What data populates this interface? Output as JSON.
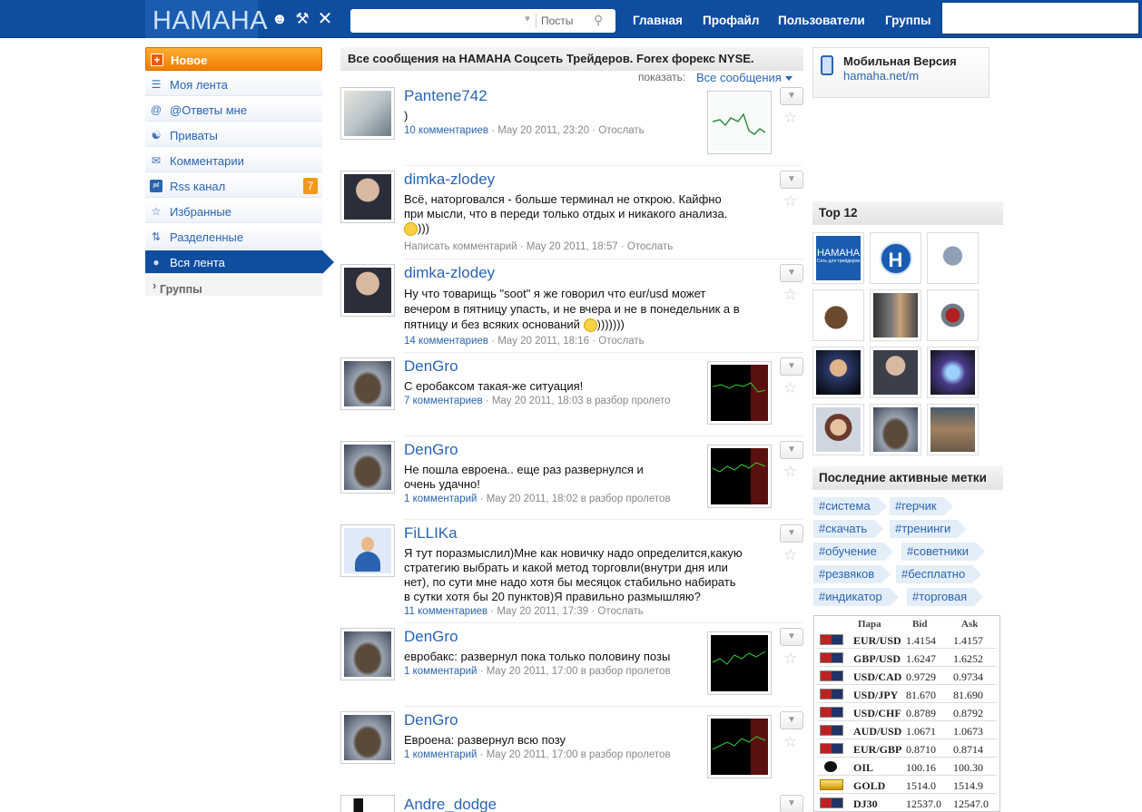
{
  "header": {
    "logo": "НАМАНА",
    "icons": [
      "user-icon",
      "wrench-icon",
      "close-icon"
    ],
    "search": {
      "placeholder": "",
      "scope": "Посты"
    },
    "nav": [
      "Главная",
      "Профайл",
      "Пользователи",
      "Группы"
    ]
  },
  "menu": {
    "new": "Новое",
    "items": [
      {
        "label": "Моя лента",
        "icon": "list-icon"
      },
      {
        "label": "@Ответы мне",
        "icon": "at-icon"
      },
      {
        "label": "Приваты",
        "icon": "users-icon"
      },
      {
        "label": "Комментарии",
        "icon": "comment-icon"
      },
      {
        "label": "Rss канал",
        "icon": "rss-icon",
        "badge": "7"
      },
      {
        "label": "Избранные",
        "icon": "star-icon"
      },
      {
        "label": "Разделенные",
        "icon": "retweet-icon"
      },
      {
        "label": "Вся лента",
        "icon": "globe-icon",
        "active": true
      }
    ],
    "groups": "Группы"
  },
  "feed": {
    "title": "Все сообщения на HAMAHA Соцсеть Трейдеров. Forex форекс NYSE.",
    "show_label": "показать:",
    "show_value": "Все сообщения",
    "posts": [
      {
        "author": "Pantene742",
        "text": [
          ")"
        ],
        "comments": "10 комментариев",
        "date": "May 20 2011, 23:20",
        "extra": "Отослать"
      },
      {
        "author": "dimka-zlodey",
        "text": [
          "Всё, наторговался - больше терминал не открою. Кайфно",
          "при мысли, что в переди только отдых и никакого анализа.",
          ")))"
        ],
        "comments": "Написать комментарий",
        "date": "May 20 2011, 18:57",
        "extra": "Отослать"
      },
      {
        "author": "dimka-zlodey",
        "text": [
          "Ну что товарищь \"soot\" я же говорил что eur/usd может",
          "вечером в пятницу упасть, и не вчера и не в понедельник а в",
          "пятницу и без всяких оснований",
          ")))))))"
        ],
        "comments": "14 комментариев",
        "date": "May 20 2011, 18:16",
        "extra": "Отослать"
      },
      {
        "author": "DenGro",
        "text": [
          "С еробаксом такая-же ситуация!"
        ],
        "comments": "7 комментариев",
        "date": "May 20 2011, 18:03",
        "extra": "в разбор пролето"
      },
      {
        "author": "DenGro",
        "text": [
          "Не пошла евроена.. еще раз развернулся и",
          "очень удачно!"
        ],
        "comments": "1 комментарий",
        "date": "May 20 2011, 18:02",
        "extra": "в разбор пролетов"
      },
      {
        "author": "FiLLIKa",
        "text": [
          "Я тут поразмыслил)Мне как новичку надо определится,какую",
          "стратегию выбрать и какой метод торговли(внутри дня или",
          "нет), по сути мне надо хотя бы месяцок стабильно набирать",
          "в сутки хотя бы 20 пунктов)Я правильно размышляю?"
        ],
        "comments": "11 комментариев",
        "date": "May 20 2011, 17:39",
        "extra": "Отослать"
      },
      {
        "author": "DenGro",
        "text": [
          "евробакс: развернул пока только половину позы"
        ],
        "comments": "1 комментарий",
        "date": "May 20 2011, 17:00",
        "extra": "в разбор пролетов"
      },
      {
        "author": "DenGro",
        "text": [
          "Евроена: развернул всю позу"
        ],
        "comments": "1 комментарий",
        "date": "May 20 2011, 17:00",
        "extra": "в разбор пролетов"
      },
      {
        "author": "Andre_dodge",
        "text": [],
        "comments": "",
        "date": "",
        "extra": ""
      }
    ]
  },
  "sidebar": {
    "mobile_title": "Мобильная Версия",
    "mobile_link": "hamaha.net/m",
    "top_title": "Top 12",
    "top_logo_1": "HAMAHA",
    "top_logo_2": "Сеть для трейдеров",
    "top_logo_3": "H",
    "tags_title": "Последние активные метки",
    "tags": [
      "#система",
      "#герчик",
      "#скачать",
      "#тренинги",
      "#обучение",
      "#советники",
      "#резвяков",
      "#бесплатно",
      "#индикатор",
      "#торговая"
    ],
    "fx_headers": [
      "Пара",
      "Bid",
      "Ask"
    ],
    "fx": [
      {
        "pair": "EUR/USD",
        "bid": "1.4154",
        "ask": "1.4157"
      },
      {
        "pair": "GBP/USD",
        "bid": "1.6247",
        "ask": "1.6252"
      },
      {
        "pair": "USD/CAD",
        "bid": "0.9729",
        "ask": "0.9734"
      },
      {
        "pair": "USD/JPY",
        "bid": "81.670",
        "ask": "81.690"
      },
      {
        "pair": "USD/CHF",
        "bid": "0.8789",
        "ask": "0.8792"
      },
      {
        "pair": "AUD/USD",
        "bid": "1.0671",
        "ask": "1.0673"
      },
      {
        "pair": "EUR/GBP",
        "bid": "0.8710",
        "ask": "0.8714"
      },
      {
        "pair": "OIL",
        "bid": "100.16",
        "ask": "100.30"
      },
      {
        "pair": "GOLD",
        "bid": "1514.0",
        "ask": "1514.9"
      },
      {
        "pair": "DJ30",
        "bid": "12537.0",
        "ask": "12547.0"
      }
    ]
  }
}
